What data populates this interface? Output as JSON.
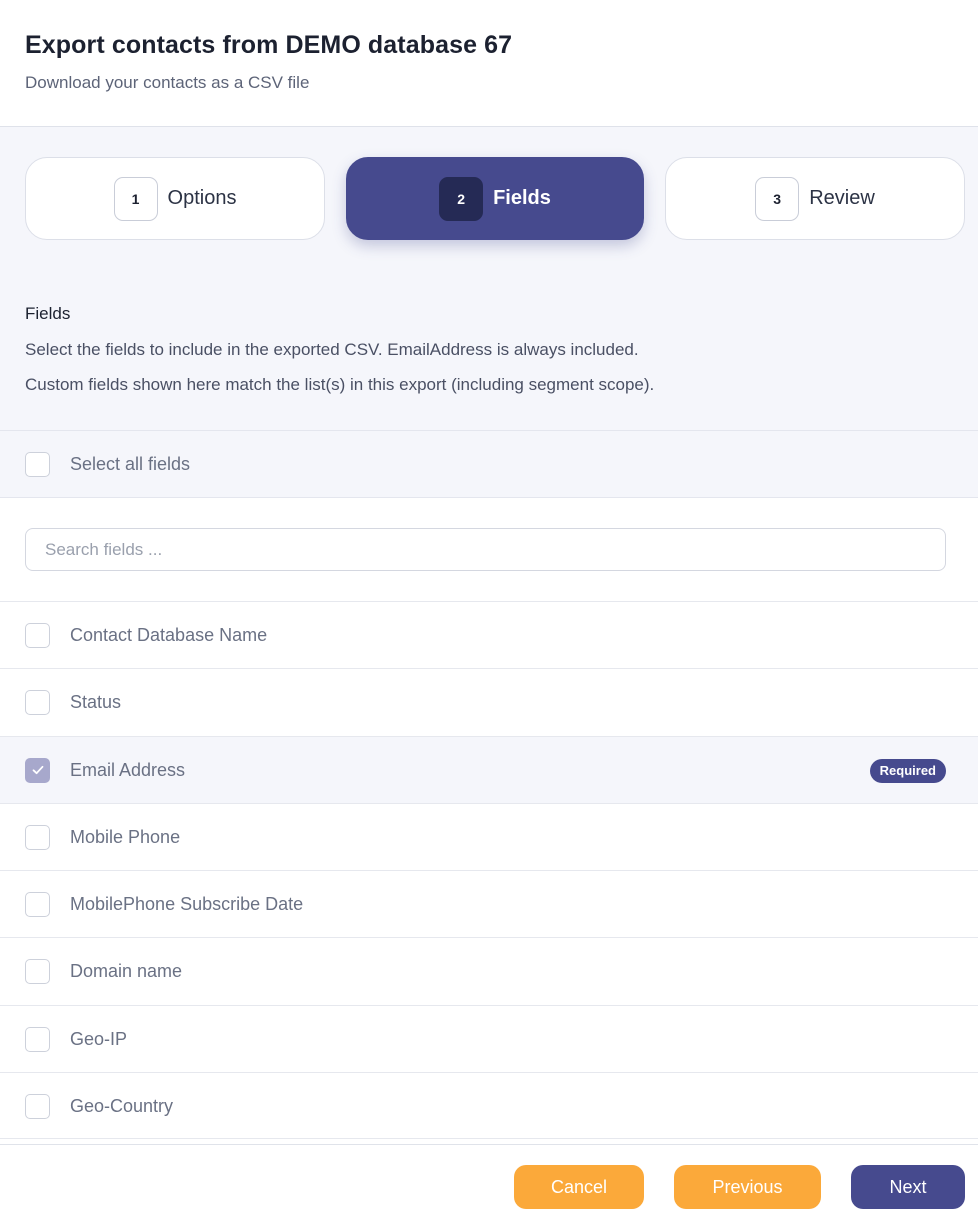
{
  "header": {
    "title": "Export contacts from DEMO database 67",
    "subtitle": "Download your contacts as a CSV file"
  },
  "steps": [
    {
      "number": "1",
      "label": "Options",
      "active": false
    },
    {
      "number": "2",
      "label": "Fields",
      "active": true
    },
    {
      "number": "3",
      "label": "Review",
      "active": false
    }
  ],
  "section": {
    "title": "Fields",
    "description_1": "Select the fields to include in the exported CSV. EmailAddress is always included.",
    "description_2": "Custom fields shown here match the list(s) in this export (including segment scope)."
  },
  "select_all": {
    "label": "Select all fields",
    "checked": false
  },
  "search": {
    "placeholder": "Search fields ..."
  },
  "fields": [
    {
      "label": "Contact Database Name",
      "checked": false
    },
    {
      "label": "Status",
      "checked": false
    },
    {
      "label": "Email Address",
      "checked": true,
      "badge": "Required"
    },
    {
      "label": "Mobile Phone",
      "checked": false
    },
    {
      "label": "MobilePhone Subscribe Date",
      "checked": false
    },
    {
      "label": "Domain name",
      "checked": false
    },
    {
      "label": "Geo-IP",
      "checked": false
    },
    {
      "label": "Geo-Country",
      "checked": false
    }
  ],
  "footer": {
    "cancel_label": "Cancel",
    "previous_label": "Previous",
    "next_label": "Next"
  },
  "colors": {
    "accent": "#464a8e",
    "accent_dark": "#252a55",
    "secondary_button": "#fba93a",
    "panel_background": "#f5f6fb"
  }
}
